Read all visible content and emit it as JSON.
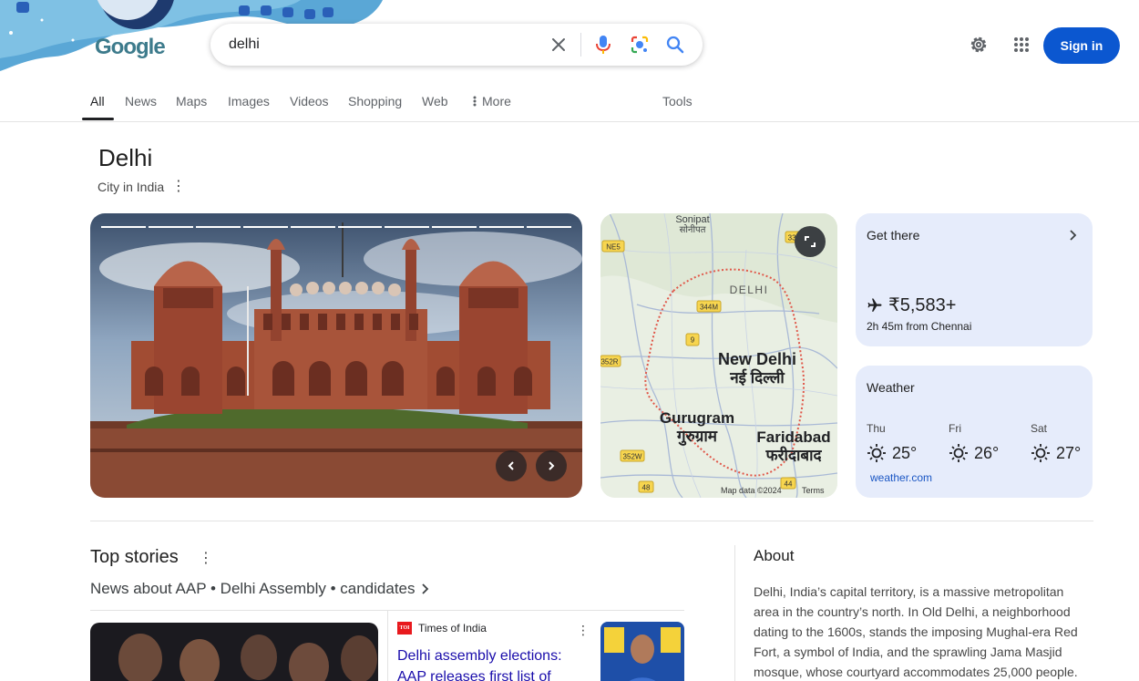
{
  "header": {
    "logo_text": "Google",
    "search_value": "delhi",
    "signin_label": "Sign in"
  },
  "tabs": [
    {
      "label": "All"
    },
    {
      "label": "News"
    },
    {
      "label": "Maps"
    },
    {
      "label": "Images"
    },
    {
      "label": "Videos"
    },
    {
      "label": "Shopping"
    },
    {
      "label": "Web"
    },
    {
      "label": "More"
    },
    {
      "label": "Tools"
    }
  ],
  "entity": {
    "title": "Delhi",
    "subtitle": "City in India"
  },
  "map": {
    "labels": {
      "sonipat": "Sonipat",
      "sonipat_hi": "सोनीपत",
      "delhi": "DELHI",
      "new_delhi": "New Delhi",
      "new_delhi_hi": "नई दिल्ली",
      "gurugram": "Gurugram",
      "gurugram_hi": "गुरुग्राम",
      "faridabad": "Faridabad",
      "faridabad_hi": "फरीदाबाद"
    },
    "shields": {
      "ne5": "NE5",
      "r334b": "334B",
      "r344m": "344M",
      "r9": "9",
      "r352r": "352R",
      "r352w": "352W",
      "r48": "48",
      "r44": "44"
    },
    "footer_data": "Map data ©2024",
    "footer_terms": "Terms"
  },
  "get_there": {
    "title": "Get there",
    "price": "₹5,583+",
    "detail": "2h 45m from Chennai"
  },
  "weather": {
    "title": "Weather",
    "days": [
      {
        "day": "Thu",
        "temp": "25°"
      },
      {
        "day": "Fri",
        "temp": "26°"
      },
      {
        "day": "Sat",
        "temp": "27°"
      }
    ],
    "source": "weather.com"
  },
  "top_stories": {
    "title": "Top stories",
    "topic": "News about AAP • Delhi Assembly • candidates",
    "story": {
      "source": "Times of India",
      "source_badge": "TOI",
      "headline": "Delhi assembly elections: AAP releases first list of"
    }
  },
  "about": {
    "title": "About",
    "text": "Delhi, India’s capital territory, is a massive metropolitan area in the country’s north. In Old Delhi, a neighborhood dating to the 1600s, stands the imposing Mughal-era Red Fort, a symbol of India, and the sprawling Jama Masjid mosque, whose courtyard accommodates 25,000 people."
  },
  "colors": {
    "signin_bg": "#0b57d0",
    "card_bg": "#e6ecfb",
    "link": "#1a0dab"
  }
}
